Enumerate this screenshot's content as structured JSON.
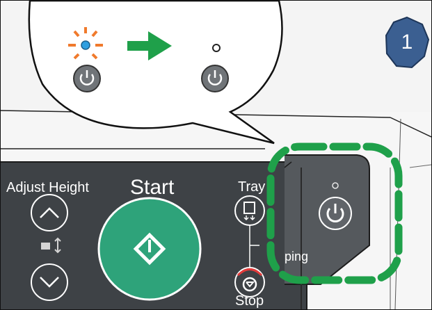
{
  "panel": {
    "adjust_height_label": "Adjust Height",
    "start_label": "Start",
    "tray_label": "Tray",
    "pairing_label_partial": "ping",
    "stop_label": "Stop"
  },
  "callout": {
    "before_state": "indicator-blinking-orange-blue",
    "after_state": "indicator-off",
    "arrow_color": "#1fa04a"
  },
  "highlight": {
    "target": "power-button",
    "color": "#1fa04a"
  },
  "step_badge": {
    "number": "1",
    "color": "#3b5f91"
  },
  "colors": {
    "panel": "#3d4145",
    "start_button": "#2ea37a",
    "indicator_orange": "#f07a2c",
    "indicator_blue": "#2f9fe0"
  }
}
